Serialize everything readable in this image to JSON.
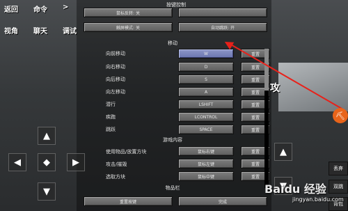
{
  "hud": {
    "back": "返回",
    "command": "命令",
    "more": ">",
    "view": "视角",
    "chat": "聊天",
    "debug": "调试",
    "attack": "攻"
  },
  "header": {
    "title": "按键控制"
  },
  "top_buttons": {
    "mouse_invert": "鼠标反转: 关",
    "touch_mode": "触屏模式: 关",
    "auto_jump": "自动跳跃: 开"
  },
  "sections": {
    "movement": "移动",
    "game_content": "游戏内容",
    "hotbar": "物品栏"
  },
  "reset_label": "重置",
  "bindings": [
    {
      "label": "向前移动",
      "key": "W"
    },
    {
      "label": "向右移动",
      "key": "D"
    },
    {
      "label": "向后移动",
      "key": "S"
    },
    {
      "label": "向左移动",
      "key": "A"
    },
    {
      "label": "潜行",
      "key": "LSHIFT"
    },
    {
      "label": "疾跑",
      "key": "LCONTROL"
    },
    {
      "label": "跳跃",
      "key": "SPACE"
    },
    {
      "label": "使用物品/放置方块",
      "key": "鼠标右键"
    },
    {
      "label": "攻击/摧毁",
      "key": "鼠标左键"
    },
    {
      "label": "选取方块",
      "key": "鼠标中键"
    }
  ],
  "bottom": {
    "reset_keys": "重置按键",
    "done": "完成"
  },
  "side": {
    "discard": "丢弃",
    "double_jump": "双跳",
    "backpack": "背包"
  },
  "dpad": {
    "up": "▲",
    "down": "▼",
    "left": "◀",
    "right": "▶",
    "center": "◆",
    "jump_up": "▲",
    "jump_down": "▼"
  },
  "watermark": {
    "main": "Baidu 经验",
    "sub": "jingyan.baidu.com"
  },
  "colors": {
    "accent_arrow": "#e8211a",
    "active_binding": "#7b84bd"
  }
}
